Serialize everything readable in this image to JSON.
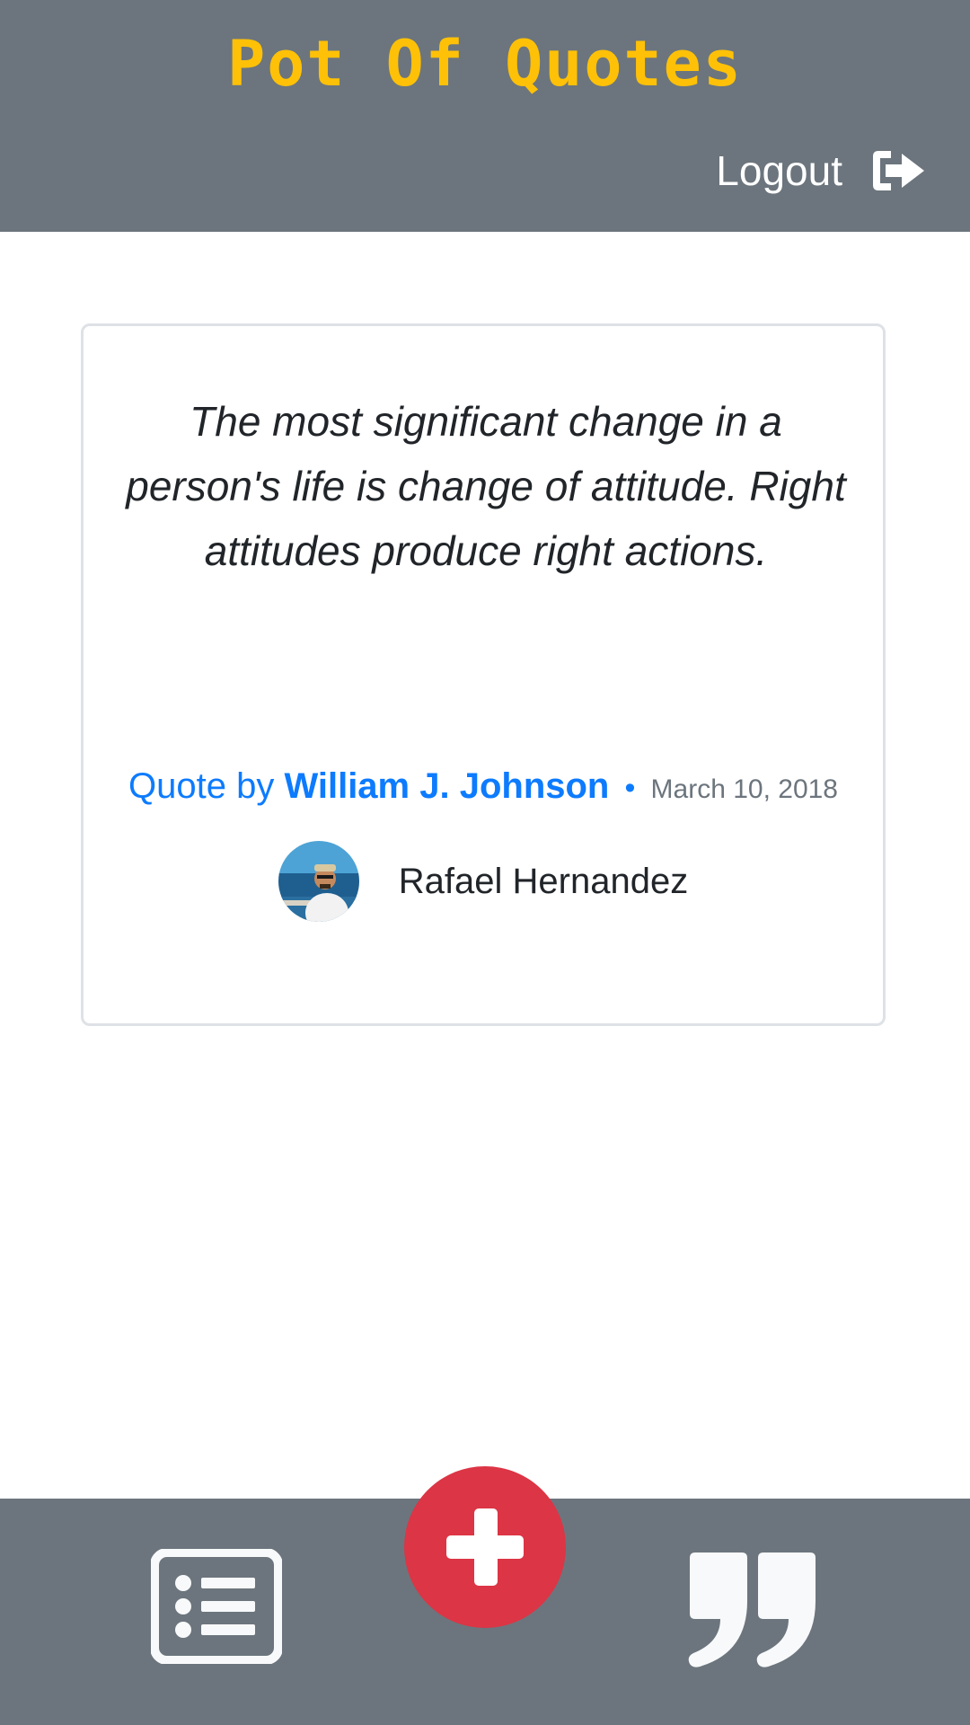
{
  "header": {
    "title": "Pot Of Quotes",
    "logout_label": "Logout",
    "logout_icon": "sign-out-icon"
  },
  "quote": {
    "text": "The most significant change in a person's life is change of attitude. Right attitudes produce right actions.",
    "by_prefix": "Quote by",
    "author": "William J. Johnson",
    "separator": "•",
    "date": "March 10, 2018",
    "posted_by": "Rafael Hernandez"
  },
  "footer": {
    "list_icon": "list-icon",
    "add_icon": "plus-icon",
    "quote_icon": "quote-icon"
  },
  "colors": {
    "bar": "#6c757d",
    "title": "#ffc107",
    "link": "#0d7bfe",
    "add_button": "#dc3545",
    "icon": "#f8f9fa"
  }
}
